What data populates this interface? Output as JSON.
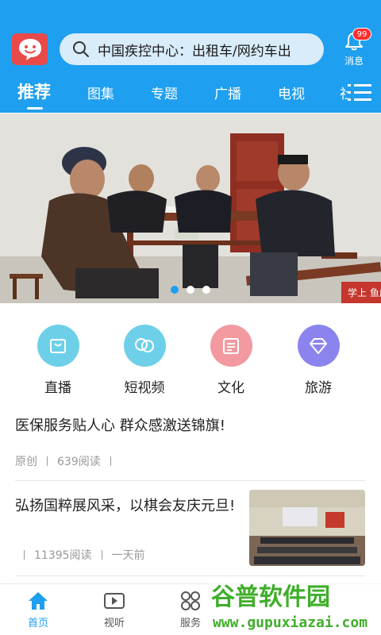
{
  "header": {
    "search_text": "中国疾控中心：出租车/网约车出",
    "message_label": "消息",
    "message_badge": "99"
  },
  "tabs": [
    {
      "label": "推荐",
      "active": true
    },
    {
      "label": "图集"
    },
    {
      "label": "专题"
    },
    {
      "label": "广播"
    },
    {
      "label": "电视"
    },
    {
      "label": "社"
    }
  ],
  "banner": {
    "watermark_text": "学上 鱼庄",
    "slide_count": 3,
    "active_slide": 1
  },
  "categories": [
    {
      "label": "直播",
      "icon": "bag-icon",
      "color": "#6ed0e8"
    },
    {
      "label": "短视频",
      "icon": "chat-bubble-icon",
      "color": "#6ed0e8"
    },
    {
      "label": "文化",
      "icon": "newspaper-icon",
      "color": "#f29aa0"
    },
    {
      "label": "旅游",
      "icon": "diamond-icon",
      "color": "#8c84ee"
    }
  ],
  "articles": [
    {
      "title": "医保服务贴人心 群众感激送锦旗!",
      "source": "原创",
      "reads": "639阅读"
    },
    {
      "title": "弘扬国粹展风采，以棋会友庆元旦!",
      "reads": "11395阅读",
      "time": "一天前"
    }
  ],
  "bottom_nav": [
    {
      "label": "首页",
      "icon": "home-icon",
      "active": true
    },
    {
      "label": "视听",
      "icon": "play-icon"
    },
    {
      "label": "服务",
      "icon": "grid-icon"
    }
  ],
  "watermark": {
    "title": "谷普软件园",
    "url": "www.gupuxiazai.com"
  },
  "colors": {
    "brand_blue": "#1e9fef",
    "logo_red": "#e84a4a"
  }
}
